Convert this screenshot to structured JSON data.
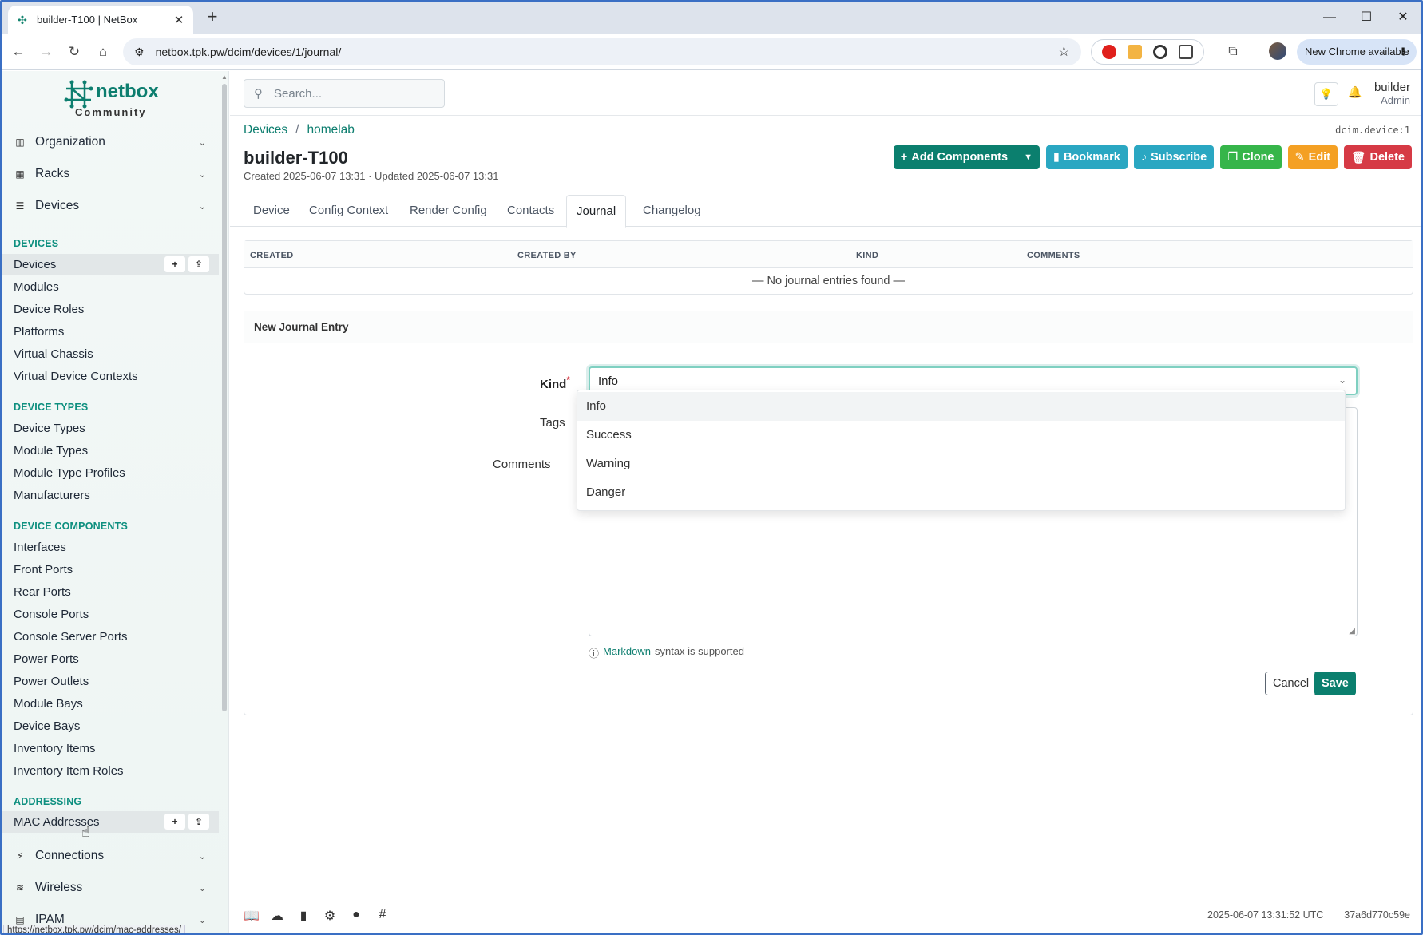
{
  "browser": {
    "tab_title": "builder-T100 | NetBox",
    "url": "netbox.tpk.pw/dcim/devices/1/journal/",
    "new_chrome_label": "New Chrome available",
    "status_url": "https://netbox.tpk.pw/dcim/mac-addresses/"
  },
  "logo": {
    "brand": "netbox",
    "sub": "Community"
  },
  "sidebar": {
    "menus": [
      {
        "label": "Organization",
        "icon": "building-icon"
      },
      {
        "label": "Racks",
        "icon": "rack-icon"
      },
      {
        "label": "Devices",
        "icon": "server-icon"
      }
    ],
    "sections": [
      {
        "title": "DEVICES",
        "items": [
          "Devices",
          "Modules",
          "Device Roles",
          "Platforms",
          "Virtual Chassis",
          "Virtual Device Contexts"
        ]
      },
      {
        "title": "DEVICE TYPES",
        "items": [
          "Device Types",
          "Module Types",
          "Module Type Profiles",
          "Manufacturers"
        ]
      },
      {
        "title": "DEVICE COMPONENTS",
        "items": [
          "Interfaces",
          "Front Ports",
          "Rear Ports",
          "Console Ports",
          "Console Server Ports",
          "Power Ports",
          "Power Outlets",
          "Module Bays",
          "Device Bays",
          "Inventory Items",
          "Inventory Item Roles"
        ]
      },
      {
        "title": "ADDRESSING",
        "items": [
          "MAC Addresses"
        ]
      }
    ],
    "bottom_menus": [
      {
        "label": "Connections",
        "icon": "plug-icon"
      },
      {
        "label": "Wireless",
        "icon": "wifi-icon"
      },
      {
        "label": "IPAM",
        "icon": "ipam-icon"
      }
    ]
  },
  "topbar": {
    "search_placeholder": "Search...",
    "user_name": "builder",
    "user_role": "Admin"
  },
  "page": {
    "breadcrumbs": [
      "Devices",
      "homelab"
    ],
    "object_id": "dcim.device:1",
    "title": "builder-T100",
    "meta": "Created 2025-06-07 13:31 · Updated 2025-06-07 13:31",
    "actions": {
      "add_components": "Add Components",
      "bookmark": "Bookmark",
      "subscribe": "Subscribe",
      "clone": "Clone",
      "edit": "Edit",
      "delete": "Delete"
    },
    "tabs": [
      "Device",
      "Config Context",
      "Render Config",
      "Contacts",
      "Journal",
      "Changelog"
    ],
    "active_tab": "Journal"
  },
  "journal_table": {
    "columns": [
      "CREATED",
      "CREATED BY",
      "KIND",
      "COMMENTS"
    ],
    "empty_text": "— No journal entries found —"
  },
  "form": {
    "header": "New Journal Entry",
    "kind_label": "Kind",
    "tags_label": "Tags",
    "comments_label": "Comments",
    "kind_value": "Info",
    "kind_options": [
      "Info",
      "Success",
      "Warning",
      "Danger"
    ],
    "hint_link": "Markdown",
    "hint_text": "syntax is supported",
    "cancel_label": "Cancel",
    "save_label": "Save"
  },
  "footer": {
    "timestamp": "2025-06-07 13:31:52 UTC",
    "commit": "37a6d770c59e"
  },
  "colors": {
    "primary": "#0b7f6e",
    "cyan": "#2aa7c2",
    "green": "#36b54a",
    "orange": "#f4a023",
    "red": "#d63a45"
  }
}
